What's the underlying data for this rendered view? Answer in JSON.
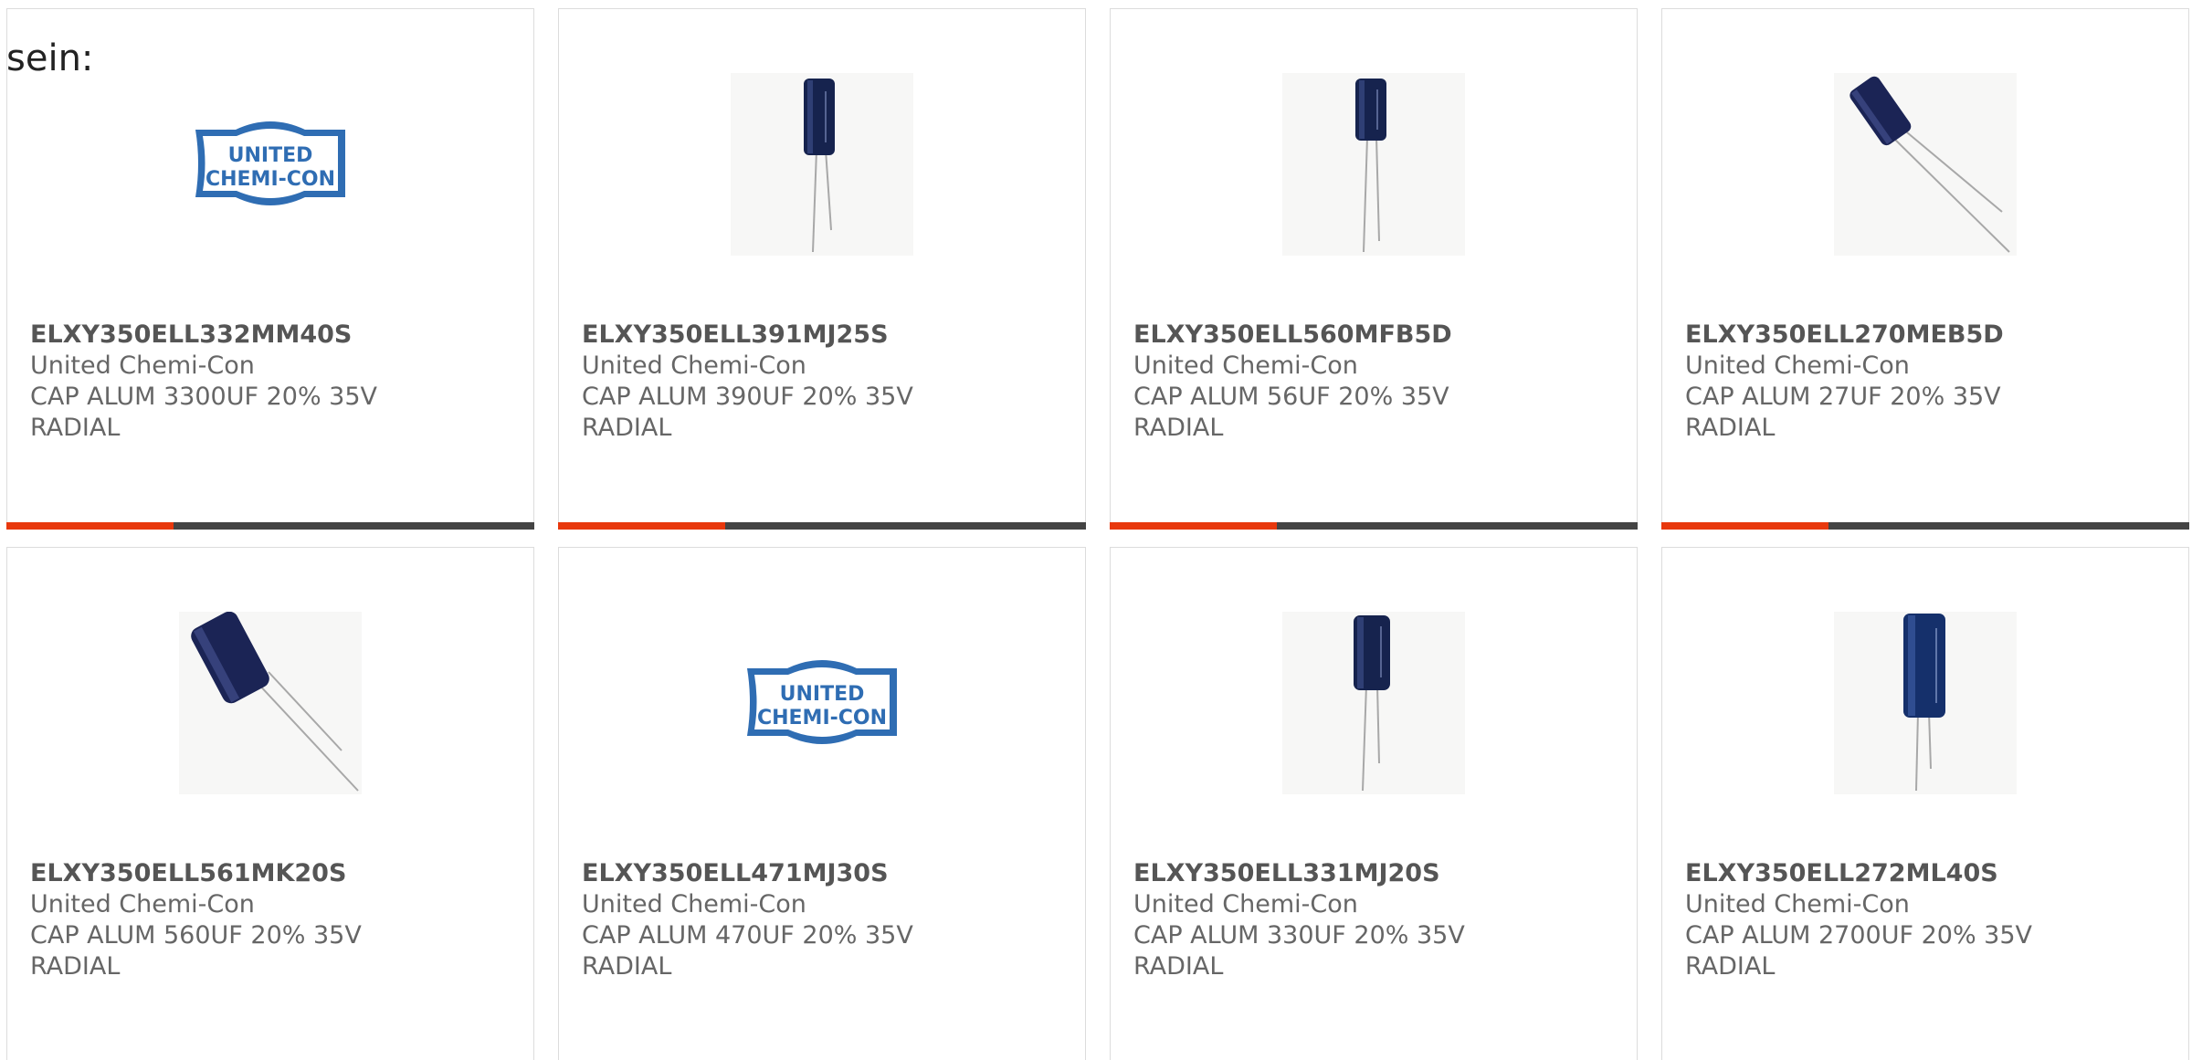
{
  "intro_text": "sein:",
  "colors": {
    "accent": "#e8380d",
    "bar_dark": "#444444",
    "logo_blue": "#2f6db3",
    "text_gray": "#666666"
  },
  "products": [
    {
      "part_number": "ELXY350ELL332MM40S",
      "manufacturer": "United Chemi-Con",
      "description": "CAP ALUM 3300UF 20% 35V",
      "mounting": "RADIAL",
      "image": "manufacturer-logo",
      "logo_line1": "UNITED",
      "logo_line2": "CHEMI-CON"
    },
    {
      "part_number": "ELXY350ELL391MJ25S",
      "manufacturer": "United Chemi-Con",
      "description": "CAP ALUM 390UF 20% 35V",
      "mounting": "RADIAL",
      "image": "capacitor-photo"
    },
    {
      "part_number": "ELXY350ELL560MFB5D",
      "manufacturer": "United Chemi-Con",
      "description": "CAP ALUM 56UF 20% 35V",
      "mounting": "RADIAL",
      "image": "capacitor-photo"
    },
    {
      "part_number": "ELXY350ELL270MEB5D",
      "manufacturer": "United Chemi-Con",
      "description": "CAP ALUM 27UF 20% 35V",
      "mounting": "RADIAL",
      "image": "capacitor-photo"
    },
    {
      "part_number": "ELXY350ELL561MK20S",
      "manufacturer": "United Chemi-Con",
      "description": "CAP ALUM 560UF 20% 35V",
      "mounting": "RADIAL",
      "image": "capacitor-photo"
    },
    {
      "part_number": "ELXY350ELL471MJ30S",
      "manufacturer": "United Chemi-Con",
      "description": "CAP ALUM 470UF 20% 35V",
      "mounting": "RADIAL",
      "image": "manufacturer-logo",
      "logo_line1": "UNITED",
      "logo_line2": "CHEMI-CON"
    },
    {
      "part_number": "ELXY350ELL331MJ20S",
      "manufacturer": "United Chemi-Con",
      "description": "CAP ALUM 330UF 20% 35V",
      "mounting": "RADIAL",
      "image": "capacitor-photo"
    },
    {
      "part_number": "ELXY350ELL272ML40S",
      "manufacturer": "United Chemi-Con",
      "description": "CAP ALUM 2700UF 20% 35V",
      "mounting": "RADIAL",
      "image": "capacitor-photo"
    }
  ]
}
